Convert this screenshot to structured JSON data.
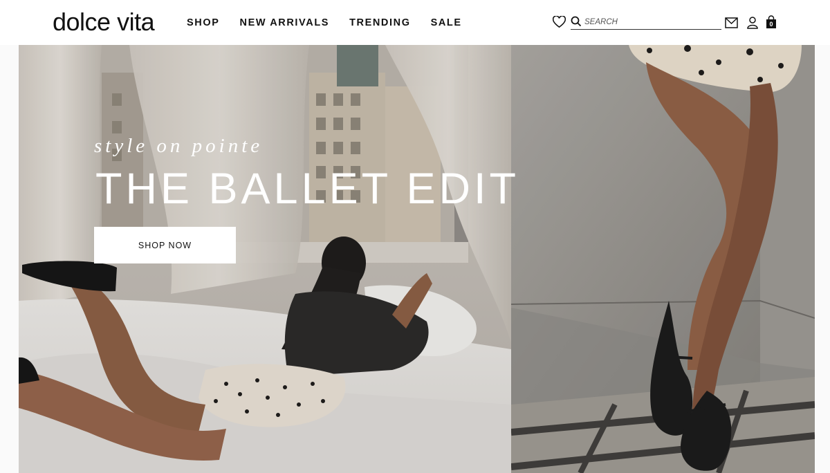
{
  "brand": {
    "logo_text": "dolce vita"
  },
  "nav": {
    "items": [
      "SHOP",
      "NEW ARRIVALS",
      "TRENDING",
      "SALE"
    ]
  },
  "header_icons": [
    "heart-icon",
    "search-icon",
    "mail-icon",
    "user-icon",
    "bag-icon"
  ],
  "search": {
    "placeholder": "SEARCH",
    "value": ""
  },
  "cart": {
    "count": "0"
  },
  "hero": {
    "tagline": "style on pointe",
    "headline": "THE BALLET EDIT",
    "cta_label": "SHOP NOW"
  },
  "colors": {
    "text": "#111111",
    "background": "#ffffff",
    "hero_text": "#ffffff"
  }
}
